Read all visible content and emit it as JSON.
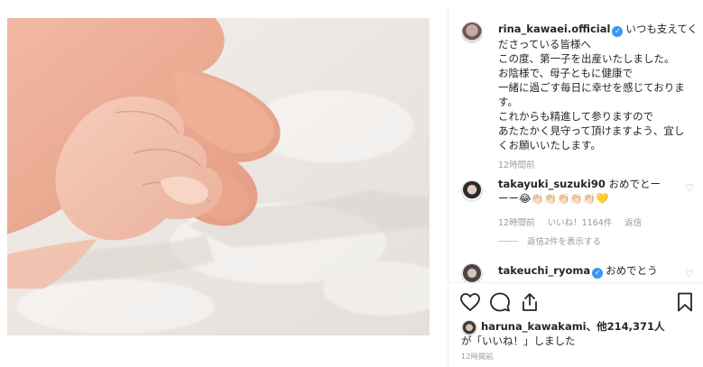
{
  "post": {
    "username": "rina_kawaei.official",
    "caption_lines": [
      "いつも支えてく",
      "ださっている皆様へ",
      "この度、第一子を出産いたしました。",
      "お陰様で、母子ともに健康で",
      "一緒に過ごす毎日に幸せを感じておりま",
      "す。",
      "これからも精進して参りますので",
      "あたたかく見守って頂けますよう、宜し",
      "くお願いいたします。"
    ],
    "time": "12時間前"
  },
  "comments": [
    {
      "username": "takayuki_suzuki90",
      "text_line1": "おめでとー",
      "text_line2": "ーー😂👏🏻👏🏻👏🏻👏🏻👏🏻💛",
      "time": "12時間前",
      "likes": "いいね！1164件",
      "reply": "返信",
      "view_replies": "返信2件を表示する"
    },
    {
      "username": "takeuchi_ryoma",
      "text": "おめでとう"
    }
  ],
  "likes": {
    "username": "haruna_kawakami",
    "suffix": "、他214,371人",
    "line2": "が「いいね！」しました"
  },
  "post_time_small": "12時間前",
  "icons": {
    "verified": "verified-badge-icon",
    "like": "heart-icon",
    "comment": "comment-bubble-icon",
    "share": "share-icon",
    "save": "bookmark-icon"
  },
  "colors": {
    "verified": "#3897f0",
    "muted": "#999999",
    "text": "#262626"
  }
}
